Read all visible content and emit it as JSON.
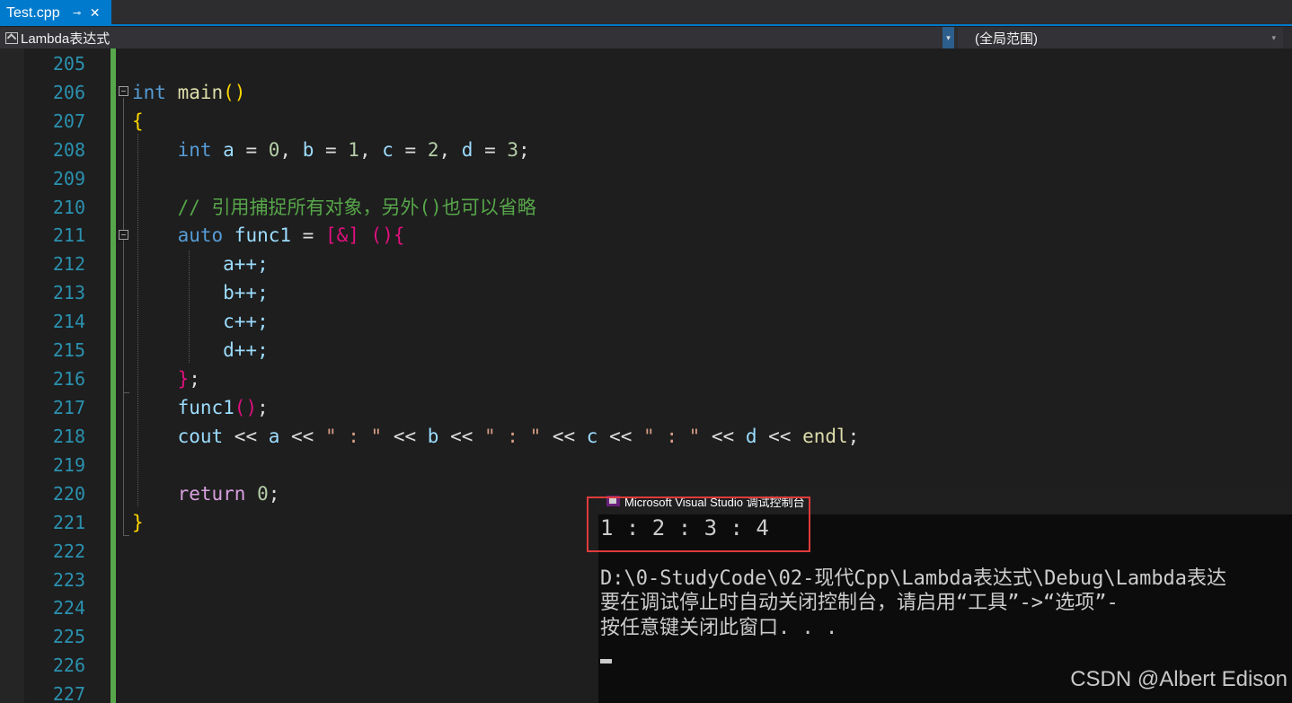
{
  "tab": {
    "title": "Test.cpp",
    "pin_icon": "pin-icon",
    "close_icon": "close-icon",
    "pin_glyph": "⊸",
    "close_glyph": "✕"
  },
  "nav": {
    "scope": "Lambda表达式",
    "member": "(全局范围)"
  },
  "editor": {
    "line_numbers": [
      "205",
      "206",
      "207",
      "208",
      "209",
      "210",
      "211",
      "212",
      "213",
      "214",
      "215",
      "216",
      "217",
      "218",
      "219",
      "220",
      "221",
      "222",
      "223",
      "224",
      "225",
      "226",
      "227"
    ],
    "lines": {
      "l206_kw": "int",
      "l206_fn": " main",
      "l206_par": "()",
      "l207": "{",
      "l208_kw": "    int",
      "l208_a": " a",
      "l208_e1": " = ",
      "l208_n0": "0",
      "l208_c1": ", ",
      "l208_b": "b",
      "l208_e2": " = ",
      "l208_n1": "1",
      "l208_c2": ", ",
      "l208_c": "c",
      "l208_e3": " = ",
      "l208_n2": "2",
      "l208_c3": ", ",
      "l208_d": "d",
      "l208_e4": " = ",
      "l208_n3": "3",
      "l208_semi": ";",
      "l210": "    // 引用捕捉所有对象，另外()也可以省略",
      "l211_kw": "    auto",
      "l211_var": " func1",
      "l211_eq": " = ",
      "l211_cap": "[&]",
      "l211_sp": " ",
      "l211_par": "()",
      "l211_br": "{",
      "l212": "        a++;",
      "l213": "        b++;",
      "l214": "        c++;",
      "l215": "        d++;",
      "l216_br": "    }",
      "l216_semi": ";",
      "l217_fn": "    func1",
      "l217_par": "()",
      "l217_semi": ";",
      "l218_fn": "    cout",
      "l218_o1": " << ",
      "l218_a": "a",
      "l218_o2": " << ",
      "l218_s1": "\" : \"",
      "l218_o3": " << ",
      "l218_b": "b",
      "l218_o4": " << ",
      "l218_s2": "\" : \"",
      "l218_o5": " << ",
      "l218_c": "c",
      "l218_o6": " << ",
      "l218_s3": "\" : \"",
      "l218_o7": " << ",
      "l218_d": "d",
      "l218_o8": " << ",
      "l218_endl": "endl",
      "l218_semi": ";",
      "l220_ret": "    return",
      "l220_sp": " ",
      "l220_n": "0",
      "l220_semi": ";",
      "l221": "}"
    }
  },
  "console": {
    "title": "Microsoft Visual Studio 调试控制台",
    "output": "1 : 2 : 3 : 4",
    "path": "D:\\0-StudyCode\\02-现代Cpp\\Lambda表达式\\Debug\\Lambda表达",
    "hint1": "要在调试停止时自动关闭控制台，请启用“工具”->“选项”-",
    "hint2": "按任意键关闭此窗口. . ."
  },
  "watermark": "CSDN @Albert Edison",
  "colors": {
    "accent": "#007acc",
    "highlight_box": "#e03b3b",
    "change_bar": "#57a64a"
  }
}
